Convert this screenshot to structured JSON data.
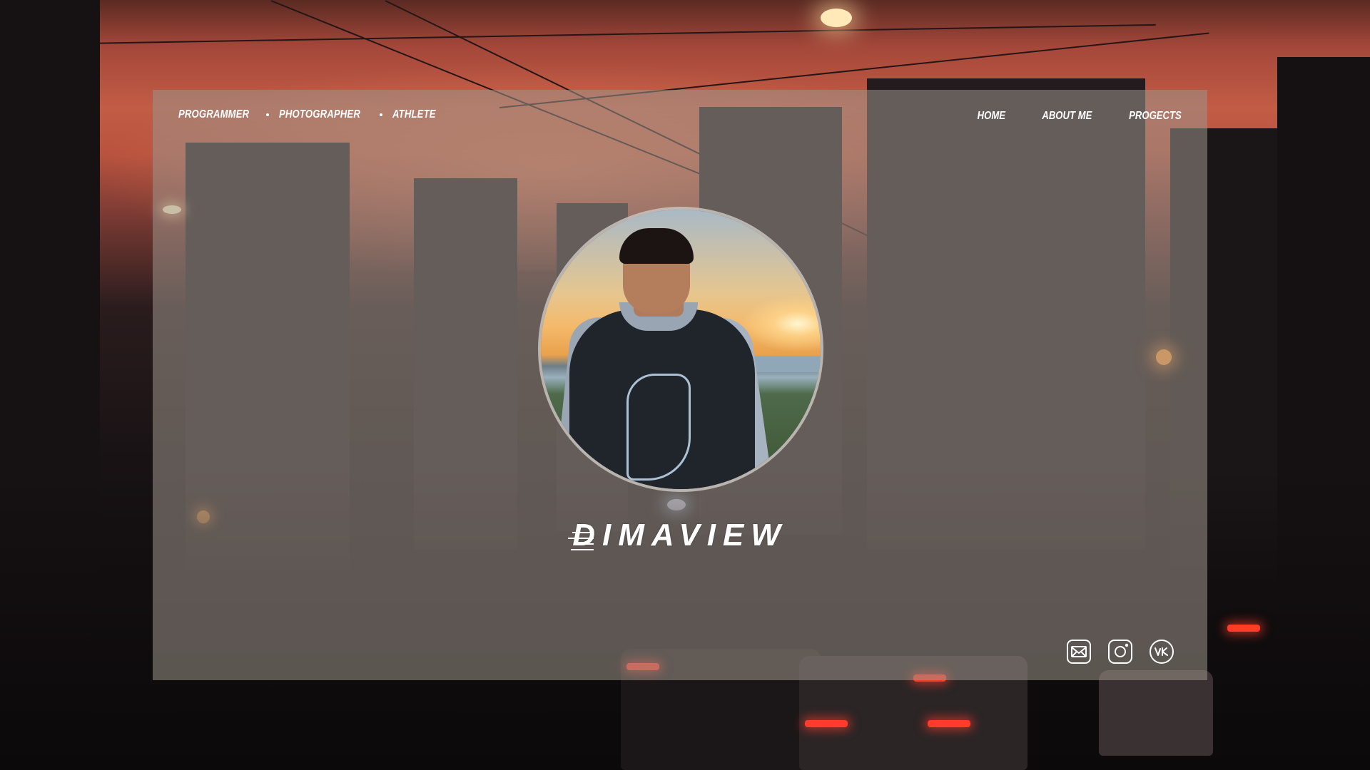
{
  "tagline": {
    "items": [
      "PROGRAMMER",
      "PHOTOGRAPHER",
      "ATHLETE"
    ]
  },
  "nav": {
    "items": [
      {
        "label": "HOME"
      },
      {
        "label": "ABOUT ME"
      },
      {
        "label": "PROGECTS"
      }
    ]
  },
  "brand": {
    "name": "DIMAVIEW"
  },
  "socials": [
    {
      "icon": "mail-icon"
    },
    {
      "icon": "instagram-icon"
    },
    {
      "icon": "vk-icon"
    }
  ],
  "colors": {
    "text": "#ffffff",
    "overlay": "#9c948a"
  }
}
